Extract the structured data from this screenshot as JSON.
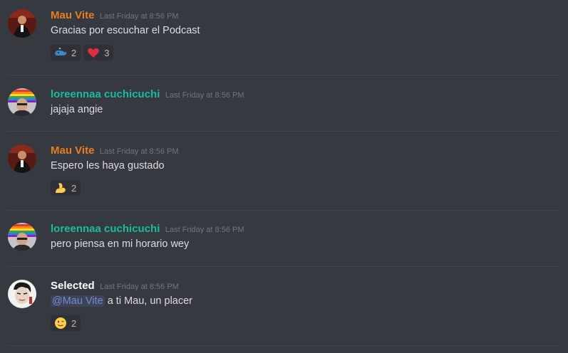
{
  "colors": {
    "background": "#36393f",
    "mau_name": "#e67e22",
    "loreen_name": "#1abc9c",
    "selected_name": "#ffffff",
    "mention": "#7289da"
  },
  "messages": [
    {
      "author": "Mau Vite",
      "timestamp": "Last Friday at 8:56 PM",
      "text": "Gracias por escuchar el Podcast",
      "reactions": [
        {
          "emoji": "whale-emoji",
          "count": "2"
        },
        {
          "emoji": "red-heart-emoji",
          "count": "3"
        }
      ]
    },
    {
      "author": "loreennaa cuchicuchi",
      "timestamp": "Last Friday at 8:56 PM",
      "text": "jajaja angie"
    },
    {
      "author": "Mau Vite",
      "timestamp": "Last Friday at 8:56 PM",
      "text": "Espero les haya gustado",
      "reactions": [
        {
          "emoji": "flexed-biceps-emoji",
          "count": "2"
        }
      ]
    },
    {
      "author": "loreennaa cuchicuchi",
      "timestamp": "Last Friday at 8:56 PM",
      "text": "pero piensa en mi horario wey"
    },
    {
      "author": "Selected",
      "timestamp": "Last Friday at 8:56 PM",
      "mention": "@Mau Vite",
      "text": " a ti Mau, un placer",
      "reactions": [
        {
          "emoji": "winking-face-emoji",
          "count": "2"
        }
      ]
    }
  ]
}
